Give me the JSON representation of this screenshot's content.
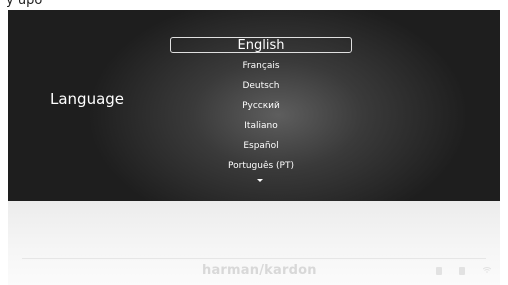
{
  "header": {
    "partial_text": "y upo"
  },
  "settings": {
    "section_label": "Language",
    "selected_language": "English",
    "languages": [
      "Français",
      "Deutsch",
      "Русский",
      "Italiano",
      "Español",
      "Português (PT)"
    ]
  },
  "device": {
    "brand": "harman/kardon",
    "icons": [
      "power-icon",
      "mute-icon",
      "wifi-icon"
    ]
  },
  "colors": {
    "screen_background": "#1e1e1e",
    "text": "#ffffff",
    "brand_text": "#d8d8d8"
  }
}
